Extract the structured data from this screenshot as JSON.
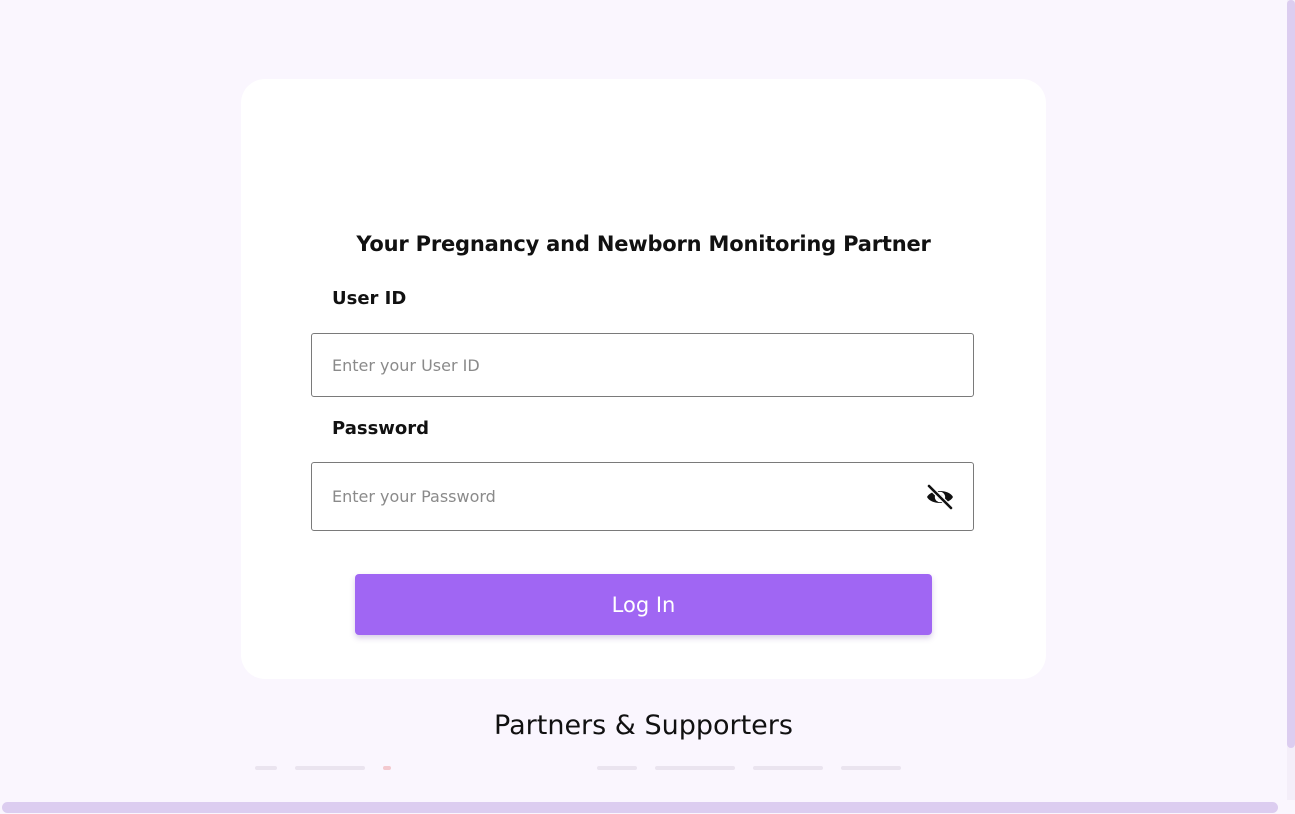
{
  "login": {
    "tagline": "Your Pregnancy and Newborn Monitoring Partner",
    "user_id_label": "User ID",
    "user_id_placeholder": "Enter your User ID",
    "password_label": "Password",
    "password_placeholder": "Enter your Password",
    "toggle_icon": "eye-off-icon",
    "login_label": "Log In"
  },
  "partners": {
    "title": "Partners & Supporters"
  },
  "colors": {
    "page_background": "#faf6fe",
    "primary_button": "#a066f3",
    "scrollbar": "#dccdf0"
  }
}
